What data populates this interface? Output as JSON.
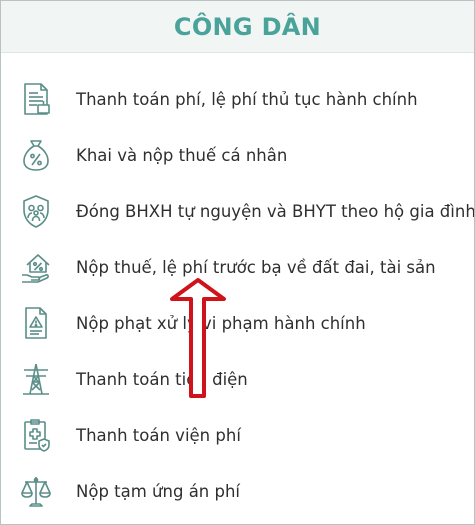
{
  "header": {
    "title": "CÔNG DÂN"
  },
  "items": [
    {
      "label": "Thanh toán phí, lệ phí thủ tục hành chính",
      "icon": "document-fee-icon"
    },
    {
      "label": "Khai và nộp thuế cá nhân",
      "icon": "money-bag-icon"
    },
    {
      "label": "Đóng BHXH tự nguyện và BHYT theo hộ gia đình",
      "icon": "family-shield-icon"
    },
    {
      "label": "Nộp thuế, lệ phí trước bạ về đất đai, tài sản",
      "icon": "house-hand-icon"
    },
    {
      "label": "Nộp phạt xử lý vi phạm hành chính",
      "icon": "warning-document-icon"
    },
    {
      "label": "Thanh toán tiền điện",
      "icon": "power-tower-icon"
    },
    {
      "label": "Thanh toán viện phí",
      "icon": "medical-clipboard-icon"
    },
    {
      "label": "Nộp tạm ứng án phí",
      "icon": "scales-icon"
    }
  ],
  "colors": {
    "accent": "#4aa39a",
    "icon_stroke": "#5a8e88",
    "arrow": "#d0121b"
  }
}
